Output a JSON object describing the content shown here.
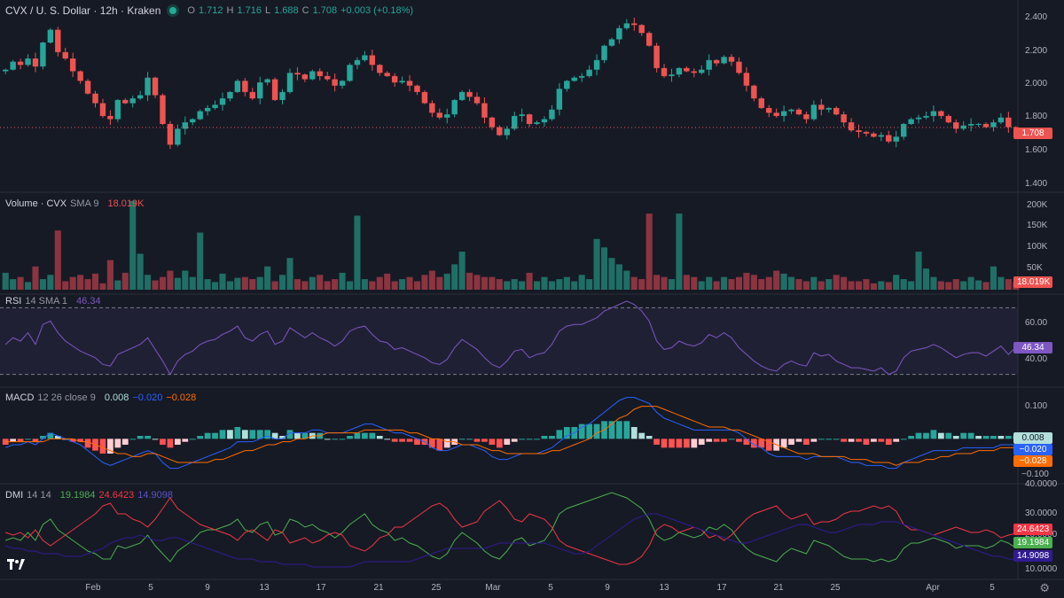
{
  "header": {
    "symbol": "CVX / U. S. Dollar · 12h · Kraken",
    "o_label": "O",
    "o": "1.712",
    "h_label": "H",
    "h": "1.716",
    "l_label": "L",
    "l": "1.688",
    "c_label": "C",
    "c": "1.708",
    "change": "+0.003 (+0.18%)"
  },
  "panes": {
    "volume": {
      "title": "Volume · CVX",
      "params": "SMA 9",
      "value": "18.019K"
    },
    "rsi": {
      "title": "RSI",
      "params": "14 SMA 1",
      "value": "46.34"
    },
    "macd": {
      "title": "MACD",
      "params": "12 26 close 9",
      "v1": "0.008",
      "v2": "−0.020",
      "v3": "−0.028"
    },
    "dmi": {
      "title": "DMI",
      "params": "14 14",
      "v1": "19.1984",
      "v2": "24.6423",
      "v3": "14.9098"
    }
  },
  "price_axis": [
    "2.400",
    "2.200",
    "2.000",
    "1.800",
    "1.600",
    "1.400"
  ],
  "volume_axis": [
    "200K",
    "150K",
    "100K",
    "50K"
  ],
  "rsi_axis": [
    "60.00",
    "40.00"
  ],
  "macd_axis": [
    "0.100",
    "−0.100"
  ],
  "dmi_axis": [
    "40.0000",
    "30.0000",
    "20.0000",
    "10.0000"
  ],
  "tags": {
    "price": "1.708",
    "volume": "18.019K",
    "rsi": "46.34",
    "macd": "0.008",
    "signal": "−0.020",
    "hist": "−0.028",
    "dmi_minus": "24.6423",
    "dmi_plus": "19.1984",
    "adx": "14.9098"
  },
  "date_labels": [
    "Feb",
    "5",
    "9",
    "13",
    "17",
    "21",
    "25",
    "Mar",
    "5",
    "9",
    "13",
    "17",
    "21",
    "25",
    "Apr",
    "5"
  ],
  "colors": {
    "up": "#26a69a",
    "down": "#ef5350",
    "rsi": "#7e57c2",
    "macd": "#2962ff",
    "signal": "#ff6d00",
    "dmi_plus": "#4caf50",
    "dmi_minus": "#f23645",
    "adx": "#311b92"
  },
  "chart_data": {
    "type": "candlestick",
    "price_range": [
      1.33,
      2.44
    ],
    "closes": [
      2.07,
      2.12,
      2.1,
      2.14,
      2.09,
      2.24,
      2.32,
      2.18,
      2.14,
      2.06,
      2.0,
      1.92,
      1.86,
      1.78,
      1.76,
      1.88,
      1.86,
      1.89,
      1.91,
      2.02,
      1.91,
      1.73,
      1.6,
      1.7,
      1.74,
      1.76,
      1.81,
      1.83,
      1.85,
      1.89,
      1.93,
      2.0,
      1.93,
      1.89,
      1.99,
      2.01,
      1.88,
      1.93,
      2.05,
      2.04,
      2.01,
      2.06,
      2.03,
      2.01,
      1.97,
      2.0,
      2.1,
      2.13,
      2.16,
      2.1,
      2.05,
      2.03,
      1.99,
      2.0,
      1.97,
      1.93,
      1.86,
      1.8,
      1.77,
      1.79,
      1.88,
      1.93,
      1.9,
      1.86,
      1.77,
      1.71,
      1.66,
      1.7,
      1.78,
      1.79,
      1.73,
      1.74,
      1.76,
      1.82,
      1.95,
      2.0,
      2.02,
      2.03,
      2.07,
      2.13,
      2.22,
      2.26,
      2.33,
      2.36,
      2.35,
      2.3,
      2.22,
      2.08,
      2.03,
      2.04,
      2.08,
      2.06,
      2.05,
      2.07,
      2.13,
      2.11,
      2.15,
      2.12,
      2.05,
      1.97,
      1.89,
      1.83,
      1.8,
      1.78,
      1.81,
      1.82,
      1.79,
      1.76,
      1.85,
      1.82,
      1.83,
      1.79,
      1.74,
      1.69,
      1.68,
      1.67,
      1.65,
      1.66,
      1.62,
      1.65,
      1.73,
      1.76,
      1.77,
      1.78,
      1.81,
      1.78,
      1.74,
      1.7,
      1.72,
      1.73,
      1.73,
      1.71,
      1.74,
      1.77,
      1.71,
      1.708
    ],
    "volume_range": [
      0,
      220000
    ],
    "volume": [
      40000,
      25000,
      30000,
      18000,
      55000,
      25000,
      35000,
      140000,
      20000,
      30000,
      35000,
      25000,
      38000,
      15000,
      70000,
      22000,
      40000,
      210000,
      85000,
      35000,
      22000,
      30000,
      45000,
      28000,
      45000,
      30000,
      135000,
      25000,
      18000,
      38000,
      20000,
      28000,
      30000,
      25000,
      30000,
      55000,
      20000,
      35000,
      75000,
      25000,
      20000,
      30000,
      35000,
      20000,
      25000,
      40000,
      20000,
      175000,
      25000,
      20000,
      30000,
      38000,
      20000,
      25000,
      30000,
      20000,
      35000,
      45000,
      30000,
      38000,
      60000,
      90000,
      40000,
      35000,
      30000,
      30000,
      25000,
      20000,
      25000,
      20000,
      40000,
      20000,
      30000,
      20000,
      25000,
      30000,
      20000,
      35000,
      25000,
      120000,
      100000,
      75000,
      60000,
      45000,
      30000,
      25000,
      180000,
      35000,
      30000,
      25000,
      180000,
      35000,
      30000,
      20000,
      30000,
      20000,
      30000,
      25000,
      30000,
      40000,
      35000,
      25000,
      30000,
      45000,
      38000,
      30000,
      25000,
      20000,
      30000,
      20000,
      25000,
      35000,
      30000,
      20000,
      20000,
      25000,
      15000,
      20000,
      18000,
      35000,
      25000,
      20000,
      90000,
      50000,
      30000,
      20000,
      18000,
      25000,
      20000,
      30000,
      22000,
      18000,
      55000,
      30000,
      25000,
      18019
    ],
    "rsi_range": [
      25,
      75
    ],
    "rsi": [
      48,
      52,
      50,
      55,
      48,
      60,
      62,
      55,
      50,
      47,
      44,
      42,
      40,
      36,
      35,
      42,
      44,
      46,
      48,
      52,
      45,
      38,
      30,
      38,
      42,
      44,
      48,
      50,
      51,
      54,
      56,
      59,
      52,
      50,
      54,
      56,
      48,
      50,
      58,
      55,
      52,
      55,
      52,
      50,
      47,
      50,
      56,
      58,
      59,
      54,
      50,
      49,
      45,
      46,
      44,
      42,
      40,
      37,
      36,
      39,
      46,
      51,
      48,
      45,
      40,
      36,
      34,
      38,
      44,
      45,
      40,
      42,
      43,
      48,
      56,
      59,
      60,
      60,
      62,
      64,
      68,
      70,
      72,
      74,
      72,
      68,
      62,
      50,
      45,
      46,
      50,
      48,
      47,
      49,
      54,
      52,
      55,
      52,
      46,
      42,
      38,
      35,
      33,
      32,
      36,
      38,
      36,
      35,
      43,
      41,
      42,
      38,
      36,
      34,
      34,
      33,
      32,
      34,
      30,
      32,
      40,
      44,
      45,
      46,
      48,
      46,
      43,
      40,
      42,
      43,
      43,
      41,
      44,
      47,
      42,
      46.34
    ],
    "macd_range": [
      -0.14,
      0.16
    ],
    "macd": [
      -0.03,
      -0.02,
      -0.02,
      -0.01,
      -0.02,
      0.0,
      0.02,
      0.01,
      0.0,
      -0.01,
      -0.02,
      -0.04,
      -0.06,
      -0.08,
      -0.09,
      -0.08,
      -0.07,
      -0.06,
      -0.05,
      -0.04,
      -0.05,
      -0.08,
      -0.1,
      -0.1,
      -0.09,
      -0.08,
      -0.07,
      -0.06,
      -0.05,
      -0.04,
      -0.03,
      -0.01,
      -0.01,
      -0.01,
      0.0,
      0.01,
      0.0,
      0.0,
      0.02,
      0.02,
      0.02,
      0.03,
      0.03,
      0.02,
      0.02,
      0.02,
      0.03,
      0.04,
      0.05,
      0.05,
      0.04,
      0.03,
      0.02,
      0.02,
      0.01,
      0.0,
      -0.01,
      -0.03,
      -0.04,
      -0.04,
      -0.03,
      -0.02,
      -0.02,
      -0.03,
      -0.04,
      -0.06,
      -0.07,
      -0.07,
      -0.06,
      -0.05,
      -0.05,
      -0.05,
      -0.04,
      -0.03,
      -0.01,
      0.01,
      0.02,
      0.04,
      0.05,
      0.07,
      0.09,
      0.11,
      0.13,
      0.14,
      0.14,
      0.13,
      0.12,
      0.09,
      0.07,
      0.06,
      0.05,
      0.04,
      0.03,
      0.03,
      0.03,
      0.03,
      0.03,
      0.03,
      0.02,
      0.0,
      -0.02,
      -0.03,
      -0.05,
      -0.06,
      -0.06,
      -0.06,
      -0.06,
      -0.07,
      -0.06,
      -0.06,
      -0.06,
      -0.06,
      -0.07,
      -0.08,
      -0.08,
      -0.09,
      -0.09,
      -0.09,
      -0.1,
      -0.1,
      -0.08,
      -0.07,
      -0.06,
      -0.05,
      -0.04,
      -0.04,
      -0.04,
      -0.04,
      -0.03,
      -0.03,
      -0.03,
      -0.03,
      -0.03,
      -0.02,
      -0.02,
      -0.02
    ],
    "signal": [
      -0.01,
      -0.01,
      -0.01,
      -0.01,
      -0.01,
      -0.01,
      0.0,
      0.0,
      0.0,
      0.0,
      -0.01,
      -0.01,
      -0.02,
      -0.03,
      -0.04,
      -0.05,
      -0.05,
      -0.06,
      -0.06,
      -0.05,
      -0.05,
      -0.06,
      -0.07,
      -0.08,
      -0.08,
      -0.08,
      -0.08,
      -0.08,
      -0.07,
      -0.07,
      -0.06,
      -0.05,
      -0.04,
      -0.04,
      -0.03,
      -0.02,
      -0.02,
      -0.01,
      -0.01,
      0.0,
      0.0,
      0.01,
      0.01,
      0.02,
      0.02,
      0.02,
      0.02,
      0.02,
      0.03,
      0.03,
      0.03,
      0.03,
      0.03,
      0.03,
      0.02,
      0.02,
      0.01,
      0.0,
      0.0,
      -0.01,
      -0.01,
      -0.02,
      -0.02,
      -0.02,
      -0.03,
      -0.04,
      -0.04,
      -0.05,
      -0.05,
      -0.05,
      -0.05,
      -0.05,
      -0.05,
      -0.04,
      -0.04,
      -0.03,
      -0.02,
      -0.01,
      0.0,
      0.02,
      0.03,
      0.05,
      0.07,
      0.08,
      0.1,
      0.11,
      0.11,
      0.11,
      0.1,
      0.09,
      0.08,
      0.07,
      0.06,
      0.05,
      0.04,
      0.04,
      0.04,
      0.03,
      0.03,
      0.02,
      0.01,
      0.0,
      -0.01,
      -0.02,
      -0.03,
      -0.04,
      -0.05,
      -0.05,
      -0.05,
      -0.06,
      -0.06,
      -0.06,
      -0.06,
      -0.07,
      -0.07,
      -0.07,
      -0.08,
      -0.08,
      -0.08,
      -0.09,
      -0.08,
      -0.08,
      -0.08,
      -0.07,
      -0.07,
      -0.06,
      -0.06,
      -0.05,
      -0.05,
      -0.05,
      -0.04,
      -0.04,
      -0.04,
      -0.03,
      -0.03,
      -0.03
    ],
    "dmi_range": [
      8,
      42
    ],
    "dmi_plus": [
      22,
      23,
      22,
      25,
      22,
      28,
      30,
      26,
      24,
      22,
      20,
      18,
      17,
      15,
      15,
      20,
      19,
      20,
      21,
      24,
      20,
      17,
      14,
      18,
      20,
      22,
      25,
      26,
      26,
      27,
      28,
      30,
      26,
      25,
      28,
      29,
      24,
      25,
      30,
      29,
      27,
      28,
      26,
      25,
      23,
      25,
      28,
      30,
      32,
      28,
      26,
      25,
      22,
      23,
      21,
      20,
      18,
      16,
      15,
      17,
      22,
      25,
      23,
      21,
      18,
      16,
      15,
      18,
      22,
      23,
      20,
      21,
      22,
      26,
      32,
      34,
      35,
      36,
      37,
      38,
      39,
      40,
      39,
      38,
      36,
      34,
      30,
      24,
      22,
      23,
      25,
      24,
      23,
      24,
      27,
      26,
      28,
      26,
      22,
      19,
      17,
      16,
      15,
      14,
      17,
      19,
      18,
      17,
      22,
      21,
      20,
      18,
      16,
      15,
      15,
      15,
      14,
      15,
      14,
      15,
      19,
      21,
      21,
      22,
      23,
      22,
      21,
      19,
      20,
      20,
      20,
      19,
      20,
      22,
      21,
      19.1984
    ],
    "dmi_minus": [
      25,
      24,
      25,
      23,
      26,
      22,
      20,
      22,
      24,
      26,
      28,
      30,
      32,
      35,
      36,
      32,
      32,
      30,
      29,
      27,
      30,
      34,
      38,
      34,
      32,
      30,
      28,
      27,
      26,
      25,
      24,
      22,
      25,
      26,
      24,
      22,
      26,
      25,
      21,
      22,
      23,
      21,
      22,
      24,
      25,
      24,
      20,
      19,
      18,
      20,
      23,
      24,
      27,
      27,
      29,
      31,
      33,
      35,
      36,
      34,
      30,
      27,
      28,
      29,
      33,
      35,
      37,
      34,
      30,
      29,
      32,
      31,
      30,
      27,
      22,
      20,
      19,
      18,
      17,
      16,
      15,
      14,
      13,
      13,
      14,
      16,
      20,
      26,
      28,
      27,
      25,
      26,
      27,
      26,
      23,
      24,
      22,
      24,
      27,
      30,
      32,
      33,
      34,
      35,
      32,
      30,
      31,
      32,
      28,
      29,
      29,
      30,
      32,
      33,
      33,
      34,
      35,
      34,
      35,
      33,
      28,
      26,
      26,
      25,
      24,
      25,
      26,
      27,
      26,
      25,
      25,
      26,
      25,
      23,
      24,
      24.6423
    ],
    "adx": [
      20,
      19,
      19,
      18,
      18,
      17,
      17,
      17,
      16,
      16,
      16,
      17,
      18,
      19,
      21,
      22,
      23,
      23,
      24,
      23,
      22,
      22,
      23,
      23,
      22,
      21,
      20,
      19,
      18,
      17,
      16,
      15,
      15,
      15,
      14,
      14,
      14,
      13,
      13,
      13,
      13,
      12,
      12,
      12,
      12,
      12,
      12,
      13,
      14,
      14,
      14,
      14,
      14,
      14,
      14,
      15,
      16,
      17,
      18,
      19,
      19,
      19,
      19,
      19,
      19,
      20,
      21,
      21,
      21,
      21,
      21,
      21,
      21,
      20,
      19,
      18,
      17,
      17,
      18,
      20,
      22,
      24,
      26,
      28,
      30,
      31,
      32,
      32,
      31,
      30,
      29,
      28,
      27,
      26,
      25,
      24,
      23,
      22,
      21,
      21,
      22,
      23,
      24,
      25,
      26,
      27,
      28,
      28,
      27,
      26,
      25,
      25,
      26,
      27,
      28,
      28,
      28,
      29,
      29,
      29,
      28,
      27,
      26,
      25,
      24,
      23,
      22,
      21,
      20,
      19,
      18,
      17,
      16,
      16,
      15,
      14.9098
    ]
  }
}
